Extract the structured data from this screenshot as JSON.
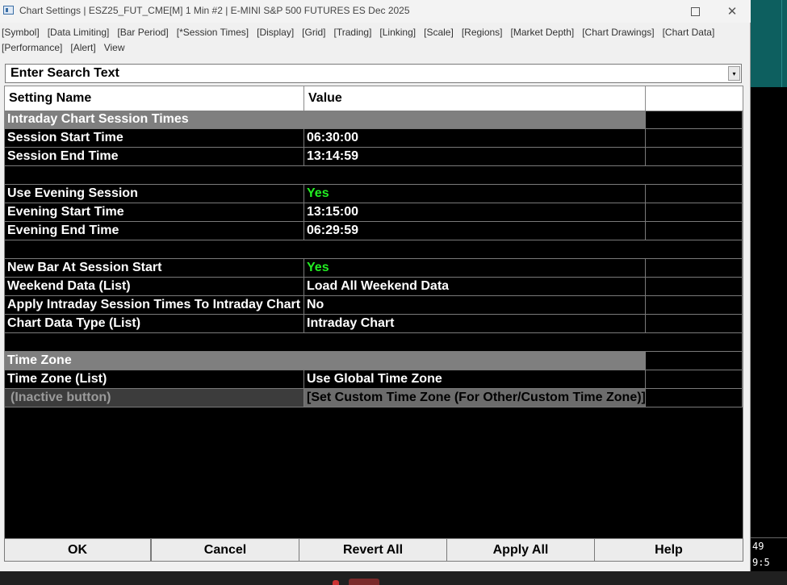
{
  "window": {
    "title": "Chart Settings | ESZ25_FUT_CME[M]  1 Min  #2 | E-MINI S&P 500 FUTURES ES Dec 2025",
    "controls": {
      "maximize": "□",
      "close": "✕"
    }
  },
  "menu": {
    "items": [
      "[Symbol]",
      "[Data Limiting]",
      "[Bar Period]",
      "[*Session Times]",
      "[Display]",
      "[Grid]",
      "[Trading]",
      "[Linking]",
      "[Scale]",
      "[Regions]",
      "[Market Depth]",
      "[Chart Drawings]",
      "[Chart Data]",
      "[Performance]",
      "[Alert]",
      "View"
    ]
  },
  "search": {
    "text": "Enter Search Text",
    "dropdown_glyph": "▾"
  },
  "table": {
    "headers": {
      "name": "Setting Name",
      "value": "Value"
    },
    "rows": [
      {
        "type": "section",
        "name": "Intraday Chart Session Times",
        "value": ""
      },
      {
        "type": "setting",
        "name": "Session Start Time",
        "value": "06:30:00"
      },
      {
        "type": "setting",
        "name": "Session End Time",
        "value": "13:14:59"
      },
      {
        "type": "blank",
        "name": "",
        "value": ""
      },
      {
        "type": "setting",
        "name": "Use Evening Session",
        "value": "Yes",
        "highlight": "green"
      },
      {
        "type": "setting",
        "name": "Evening Start Time",
        "value": "13:15:00"
      },
      {
        "type": "setting",
        "name": "Evening End Time",
        "value": "06:29:59"
      },
      {
        "type": "blank",
        "name": "",
        "value": ""
      },
      {
        "type": "setting",
        "name": "New Bar At Session Start",
        "value": "Yes",
        "highlight": "green"
      },
      {
        "type": "setting",
        "name": "Weekend Data (List)",
        "value": "Load All Weekend Data"
      },
      {
        "type": "setting",
        "name": "Apply Intraday Session Times To Intraday Chart",
        "value": "No"
      },
      {
        "type": "setting",
        "name": "Chart Data Type (List)",
        "value": "Intraday Chart"
      },
      {
        "type": "blank",
        "name": "",
        "value": ""
      },
      {
        "type": "section",
        "name": "Time Zone",
        "value": ""
      },
      {
        "type": "setting",
        "name": "Time Zone (List)",
        "value": "Use Global Time Zone"
      },
      {
        "type": "inactive",
        "name": "(Inactive button)",
        "value": "[Set Custom Time Zone (For Other/Custom Time Zone)]"
      }
    ]
  },
  "buttons": {
    "ok": "OK",
    "cancel": "Cancel",
    "revert_all": "Revert All",
    "apply_all": "Apply All",
    "help": "Help"
  },
  "background": {
    "clock_fragment": "49 9:5"
  },
  "colors": {
    "grid_bg": "#000000",
    "section_bg": "#7f7f7f",
    "yes_green": "#22ee22",
    "inactive_bg": "#3c3c3c"
  }
}
